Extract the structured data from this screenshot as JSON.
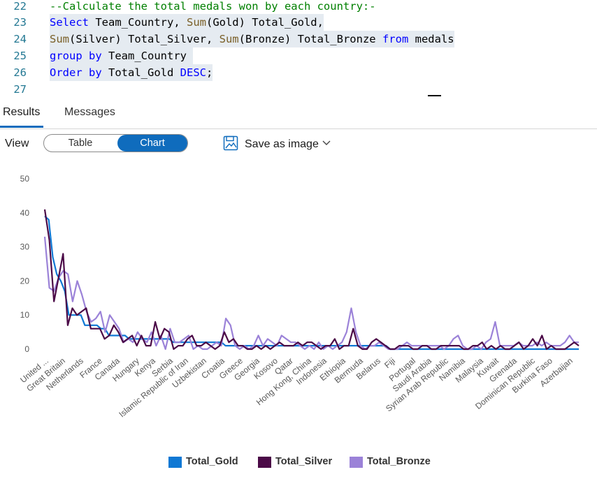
{
  "editor": {
    "lines": [
      {
        "n": "22",
        "tokens": [
          {
            "t": "--Calculate the total medals won by each country:-",
            "c": "cm"
          }
        ],
        "selected": false
      },
      {
        "n": "23",
        "tokens": [
          {
            "t": "Select",
            "c": "kw"
          },
          {
            "t": " Team_Country, ",
            "c": "tx"
          },
          {
            "t": "Sum",
            "c": "fn"
          },
          {
            "t": "(Gold) Total_Gold,",
            "c": "tx"
          }
        ],
        "selected": true
      },
      {
        "n": "24",
        "tokens": [
          {
            "t": "Sum",
            "c": "fn"
          },
          {
            "t": "(Silver) Total_Silver, ",
            "c": "tx"
          },
          {
            "t": "Sum",
            "c": "fn"
          },
          {
            "t": "(Bronze) Total_Bronze ",
            "c": "tx"
          },
          {
            "t": "from",
            "c": "kw"
          },
          {
            "t": " medals",
            "c": "tx"
          }
        ],
        "selected": true
      },
      {
        "n": "25",
        "tokens": [
          {
            "t": "group",
            "c": "kw"
          },
          {
            "t": " ",
            "c": "tx"
          },
          {
            "t": "by",
            "c": "kw"
          },
          {
            "t": " Team_Country ",
            "c": "tx"
          }
        ],
        "selected": true
      },
      {
        "n": "26",
        "tokens": [
          {
            "t": "Order",
            "c": "kw"
          },
          {
            "t": " ",
            "c": "tx"
          },
          {
            "t": "by",
            "c": "kw"
          },
          {
            "t": " Total_Gold ",
            "c": "tx"
          },
          {
            "t": "DESC",
            "c": "kw"
          },
          {
            "t": ";",
            "c": "tx"
          }
        ],
        "selected": true
      },
      {
        "n": "27",
        "tokens": [],
        "selected": false
      }
    ]
  },
  "tabs": {
    "results": "Results",
    "messages": "Messages"
  },
  "toolbar": {
    "view_label": "View",
    "table": "Table",
    "chart": "Chart",
    "save": "Save as image"
  },
  "colors": {
    "gold": "#0f78d4",
    "silver": "#4b0a47",
    "bronze": "#9b82d8",
    "accent": "#0f6cbd"
  },
  "chart_data": {
    "type": "line",
    "ylim": [
      0,
      50
    ],
    "yticks": [
      0,
      10,
      20,
      30,
      40,
      50
    ],
    "grid": false,
    "legend_position": "bottom",
    "x_labels_visible": [
      "United ...",
      "Great Britain",
      "Netherlands",
      "France",
      "Canada",
      "Hungary",
      "Kenya",
      "Serbia",
      "Islamic Republic of Iran",
      "Uzbekistan",
      "Croatia",
      "Greece",
      "Georgia",
      "Kosovo",
      "Qatar",
      "Hong Kong, China",
      "Indonesia",
      "Ethiopia",
      "Bermuda",
      "Belarus",
      "Fiji",
      "Portugal",
      "Saudi Arabia",
      "Syrian Arab Republic",
      "Namibia",
      "Malaysia",
      "Kuwait",
      "Grenada",
      "Dominican Republic",
      "Burkina Faso",
      "Azerbaijan"
    ],
    "series": [
      {
        "name": "Total_Gold",
        "values": [
          39,
          38,
          27,
          22,
          20,
          17,
          10,
          10,
          10,
          10,
          7,
          7,
          7,
          7,
          6,
          6,
          4,
          4,
          4,
          4,
          4,
          3,
          3,
          3,
          3,
          3,
          3,
          3,
          3,
          3,
          3,
          3,
          2,
          2,
          2,
          2,
          2,
          2,
          2,
          2,
          2,
          2,
          2,
          2,
          2,
          1,
          1,
          1,
          1,
          1,
          1,
          1,
          1,
          1,
          1,
          1,
          1,
          1,
          1,
          1,
          1,
          1,
          1,
          1,
          1,
          1,
          1,
          1,
          1,
          1,
          1,
          1,
          1,
          1,
          1,
          1,
          1,
          1,
          1,
          1,
          1,
          1,
          1,
          1,
          1,
          1,
          0,
          0,
          0,
          0,
          0,
          0,
          0,
          0,
          0,
          0,
          0,
          0,
          0,
          0,
          0,
          0,
          0,
          0,
          0,
          0,
          0,
          0,
          0,
          0,
          0,
          0,
          0,
          0,
          0,
          0,
          0,
          0,
          0,
          0,
          0,
          0,
          0,
          0,
          0,
          0,
          0,
          0,
          0,
          0,
          0,
          0,
          0,
          0
        ]
      },
      {
        "name": "Total_Silver",
        "values": [
          41,
          32,
          14,
          21,
          28,
          7,
          12,
          10,
          11,
          12,
          6,
          6,
          6,
          3,
          4,
          7,
          5,
          2,
          3,
          4,
          1,
          4,
          1,
          1,
          8,
          3,
          6,
          5,
          0,
          1,
          1,
          3,
          4,
          1,
          1,
          2,
          1,
          0,
          1,
          5,
          2,
          3,
          1,
          1,
          0,
          0,
          1,
          0,
          1,
          0,
          1,
          2,
          1,
          1,
          1,
          2,
          1,
          2,
          2,
          1,
          0,
          1,
          1,
          3,
          0,
          1,
          1,
          6,
          1,
          0,
          0,
          2,
          3,
          2,
          1,
          0,
          0,
          1,
          1,
          1,
          0,
          0,
          1,
          1,
          0,
          0,
          1,
          1,
          1,
          1,
          1,
          0,
          0,
          1,
          1,
          2,
          0,
          1,
          0,
          1,
          0,
          0,
          1,
          2,
          0,
          1,
          3,
          1,
          4,
          0,
          1,
          0,
          0,
          0,
          1,
          2,
          1
        ]
      },
      {
        "name": "Total_Bronze",
        "values": [
          33,
          18,
          17,
          21,
          23,
          22,
          14,
          20,
          16,
          11,
          8,
          9,
          11,
          5,
          10,
          8,
          6,
          2,
          3,
          2,
          5,
          3,
          2,
          5,
          1,
          4,
          0,
          6,
          2,
          2,
          3,
          4,
          0,
          1,
          0,
          0,
          1,
          2,
          1,
          9,
          7,
          1,
          0,
          1,
          0,
          1,
          4,
          1,
          3,
          2,
          1,
          4,
          3,
          2,
          2,
          1,
          0,
          1,
          0,
          2,
          0,
          1,
          0,
          1,
          2,
          5,
          12,
          5,
          1,
          0,
          1,
          1,
          2,
          1,
          0,
          0,
          0,
          1,
          2,
          1,
          1,
          1,
          1,
          1,
          1,
          1,
          0,
          1,
          3,
          4,
          1,
          0,
          0,
          1,
          0,
          2,
          3,
          8,
          1,
          1,
          1,
          1,
          2,
          1,
          1,
          1,
          2,
          1,
          2,
          1,
          1,
          1,
          2,
          4,
          2,
          2
        ]
      }
    ]
  }
}
